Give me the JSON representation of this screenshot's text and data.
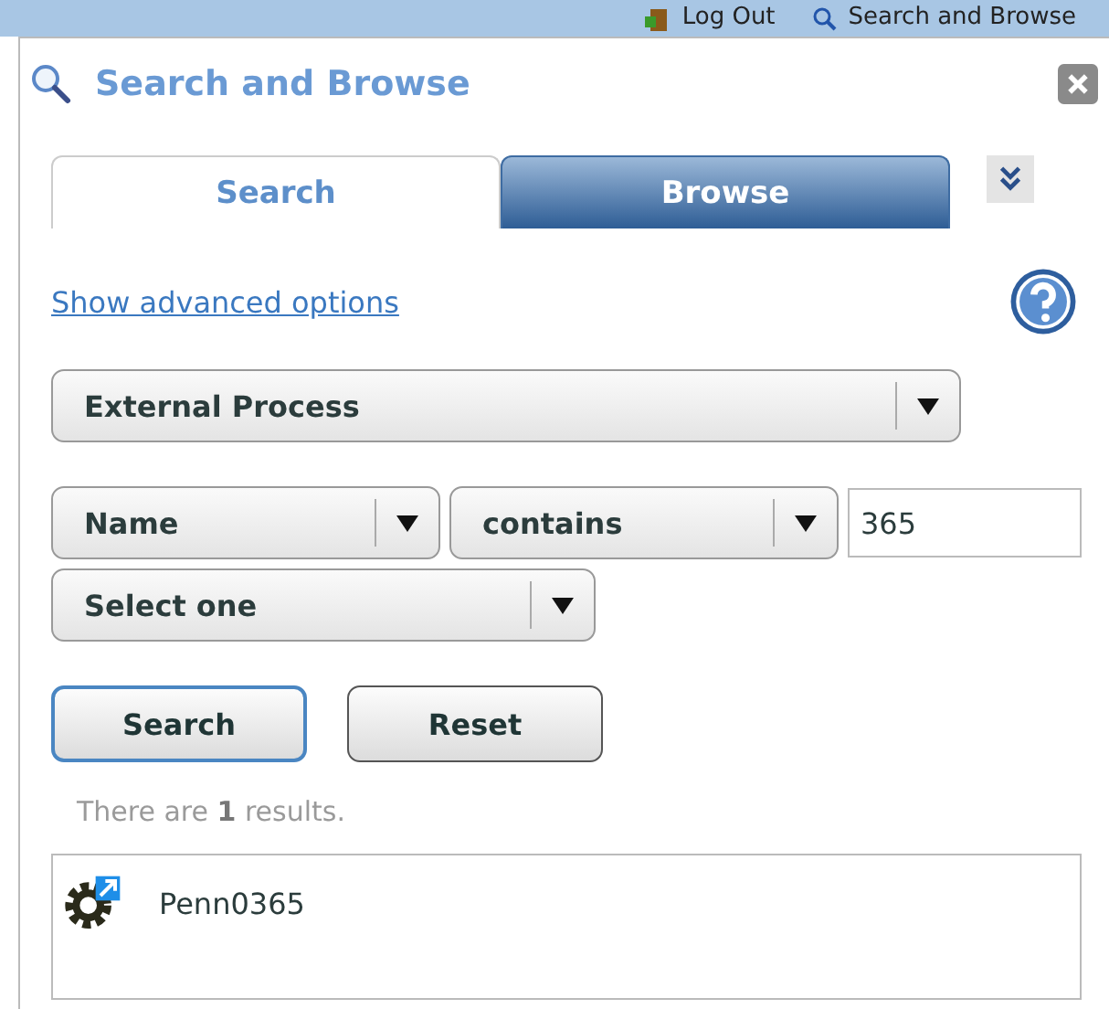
{
  "top_bar": {
    "items": [
      {
        "label": "Log Out",
        "kind": "logout"
      },
      {
        "label": "Search and Browse",
        "kind": "search"
      }
    ]
  },
  "panel": {
    "title": "Search and Browse"
  },
  "tabs": [
    {
      "label": "Search",
      "selected": true
    },
    {
      "label": "Browse",
      "selected": false
    }
  ],
  "advanced_link": "Show advanced options",
  "type_select": "External Process",
  "criteria": {
    "field": "Name",
    "operator": "contains",
    "value": "365"
  },
  "extra_select": "Select one",
  "buttons": [
    {
      "label": "Search",
      "kind": "primary"
    },
    {
      "label": "Reset",
      "kind": "normal"
    }
  ],
  "result_summary": "There are **1** results.",
  "results": [
    {
      "name": "Penn0365"
    }
  ]
}
